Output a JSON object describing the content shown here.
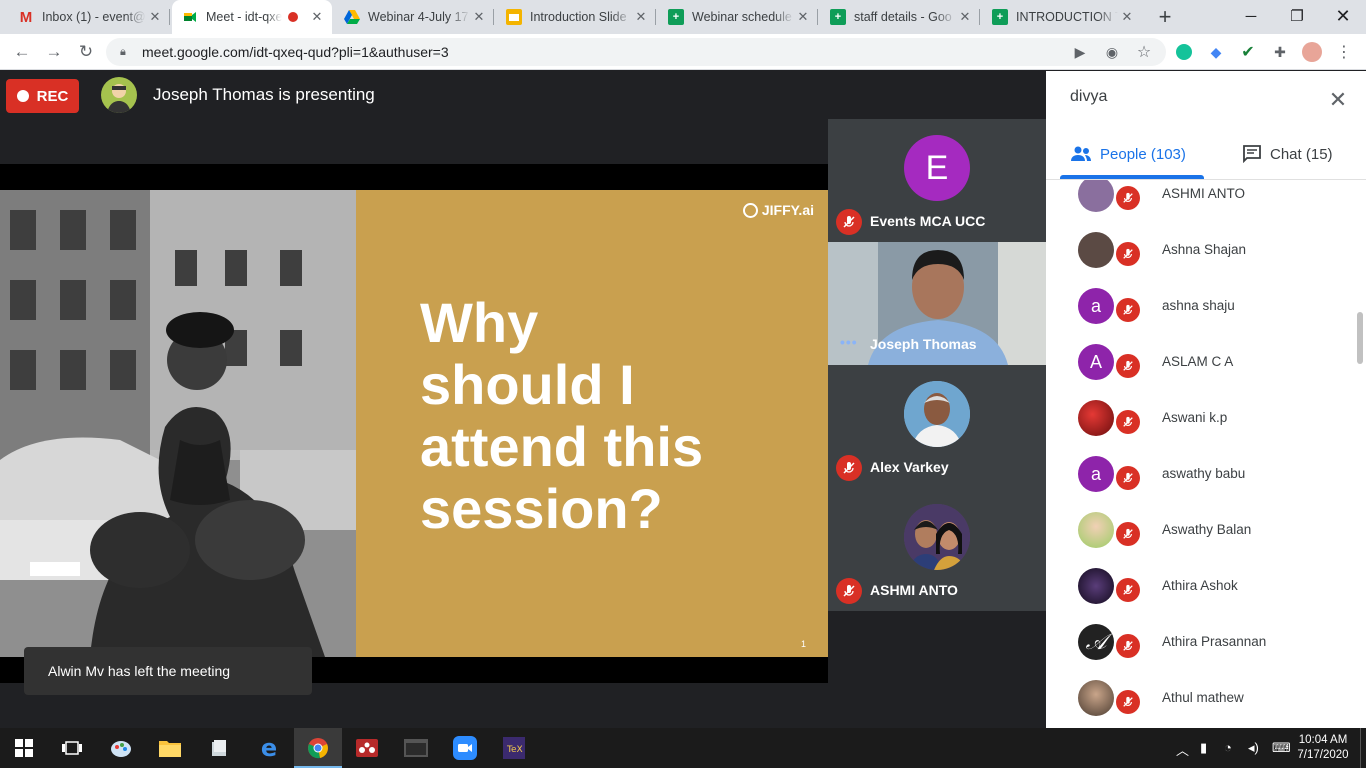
{
  "browser": {
    "tabs": [
      {
        "title": "Inbox (1) - event@",
        "icon": "gmail-icon",
        "active": false
      },
      {
        "title": "Meet - idt-qxeq",
        "icon": "meet-icon",
        "active": true
      },
      {
        "title": "Webinar 4-July 17",
        "icon": "drive-icon",
        "active": false
      },
      {
        "title": "Introduction Slide",
        "icon": "slides-icon",
        "active": false
      },
      {
        "title": "Webinar schedule",
        "icon": "sheets-icon",
        "active": false
      },
      {
        "title": "staff details - Goo",
        "icon": "sheets-icon",
        "active": false
      },
      {
        "title": "INTRODUCTION TO",
        "icon": "sheets-icon",
        "active": false
      }
    ],
    "new_tab": "+",
    "url": "meet.google.com/idt-qxeq-qud?pli=1&authuser=3"
  },
  "meet": {
    "rec_label": "REC",
    "presenting_text": "Joseph Thomas is presenting",
    "slide": {
      "title": "Why\nshould I\nattend this\nsession?",
      "logo": "JIFFY.ai",
      "page_number": "1"
    },
    "participants": [
      {
        "name": "Events MCA UCC",
        "avatar_letter": "E",
        "muted": true
      },
      {
        "name": "Joseph Thomas",
        "video": true,
        "speaking": true
      },
      {
        "name": "Alex Varkey",
        "muted": true
      },
      {
        "name": "ASHMI ANTO",
        "muted": true
      }
    ],
    "toast": "Alwin Mv has left the meeting"
  },
  "panel": {
    "title": "divya",
    "people_tab": "People (103)",
    "chat_tab": "Chat (15)",
    "people": [
      {
        "name": "ASHMI ANTO",
        "avatar": "photo",
        "color": "#8a6f9e"
      },
      {
        "name": "Ashna Shajan",
        "avatar": "photo",
        "color": "#5b4a44"
      },
      {
        "name": "ashna shaju",
        "avatar": "a",
        "color": "#8e24aa"
      },
      {
        "name": "ASLAM C A",
        "avatar": "A",
        "color": "#8e24aa"
      },
      {
        "name": "Aswani k.p",
        "avatar": "photo",
        "color": "#a61b1b"
      },
      {
        "name": "aswathy babu",
        "avatar": "a",
        "color": "#8e24aa"
      },
      {
        "name": "Aswathy Balan",
        "avatar": "photo",
        "color": "#9ccc65"
      },
      {
        "name": "Athira Ashok",
        "avatar": "photo",
        "color": "#2b1d3a"
      },
      {
        "name": "Athira Prasannan",
        "avatar": "𝒜",
        "color": "#222222"
      },
      {
        "name": "Athul mathew",
        "avatar": "photo",
        "color": "#6d5a4b"
      }
    ]
  },
  "taskbar": {
    "time": "10:04 AM",
    "date": "7/17/2020"
  }
}
